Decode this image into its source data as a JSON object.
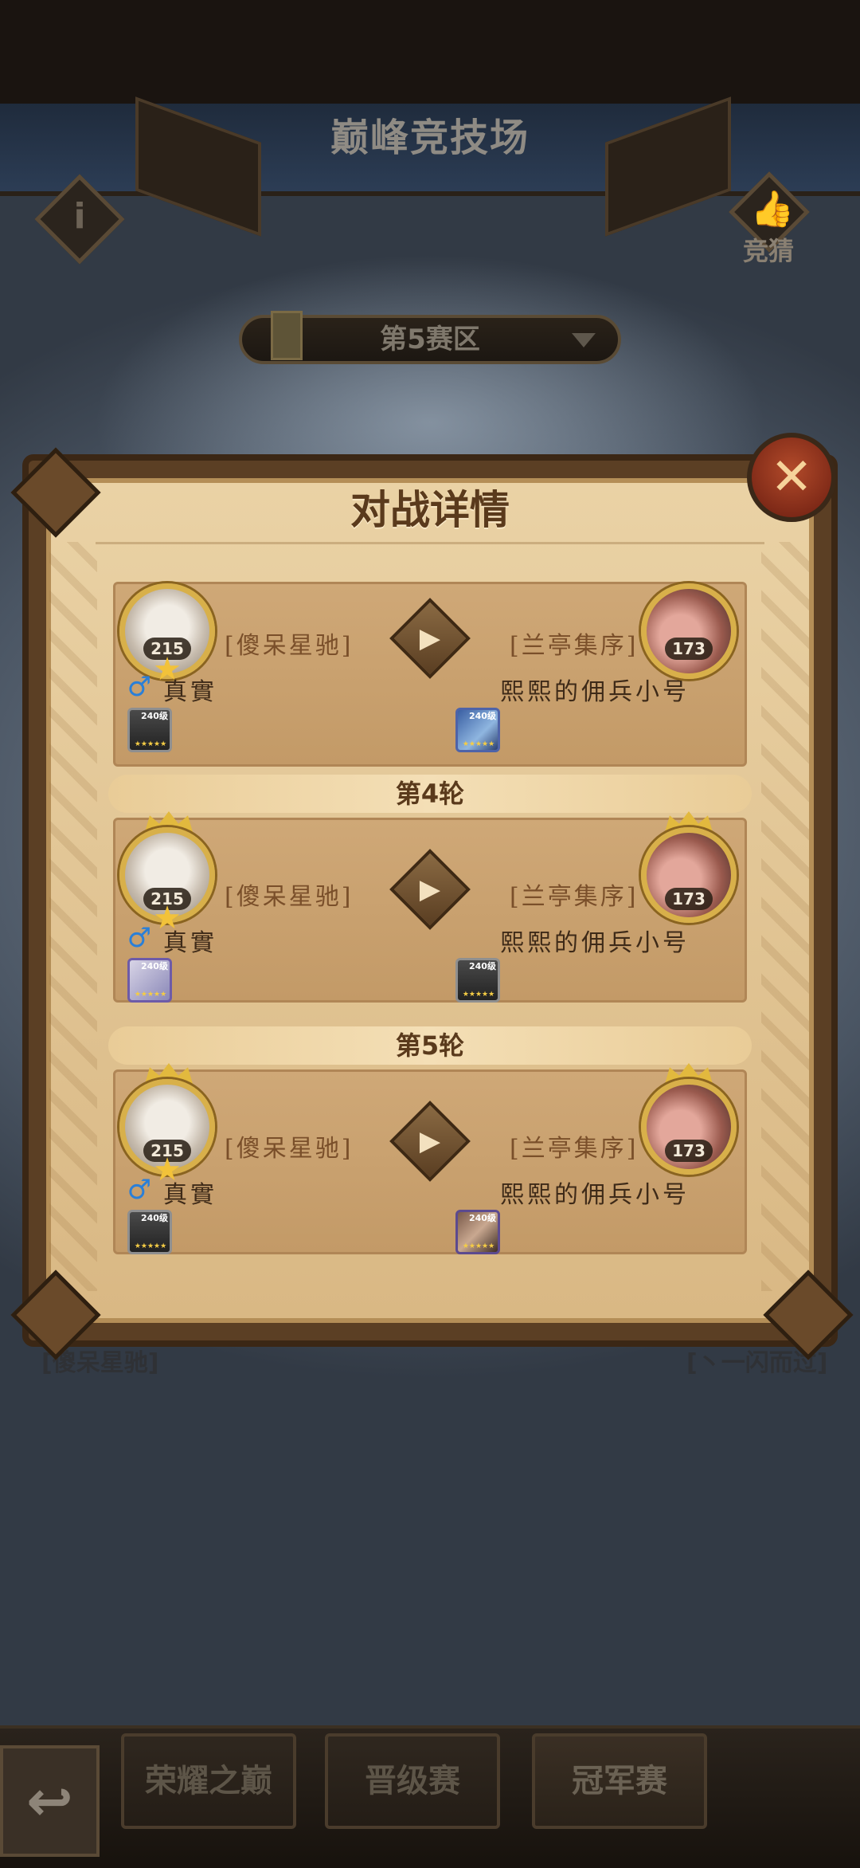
{
  "header": {
    "title": "巅峰竞技场",
    "guess_label": "竞猜"
  },
  "zone_select": {
    "value": "第5赛区"
  },
  "background_players": {
    "left": "[傻呆星驰]",
    "right": "[丶一闪而过]"
  },
  "dialog": {
    "title": "对战详情",
    "matches": [
      {
        "left": {
          "guild": "[傻呆星驰]",
          "name": "真實",
          "level": "215"
        },
        "right": {
          "guild": "[兰亭集序]",
          "name": "熙熙的佣兵小号",
          "level": "173"
        },
        "left_hero_level": "240级",
        "right_hero_level": "240级"
      },
      {
        "round_label": "第4轮",
        "left": {
          "guild": "[傻呆星驰]",
          "name": "真實",
          "level": "215"
        },
        "right": {
          "guild": "[兰亭集序]",
          "name": "熙熙的佣兵小号",
          "level": "173"
        },
        "left_hero_level": "240级",
        "right_hero_level": "240级"
      },
      {
        "round_label": "第5轮",
        "left": {
          "guild": "[傻呆星驰]",
          "name": "真實",
          "level": "215"
        },
        "right": {
          "guild": "[兰亭集序]",
          "name": "熙熙的佣兵小号",
          "level": "173"
        },
        "left_hero_level": "240级",
        "right_hero_level": "240级"
      }
    ],
    "hero_stars": "★★★★★"
  },
  "bottom_nav": {
    "tab1": "荣耀之巅",
    "tab2": "晋级赛",
    "tab3": "冠军赛"
  },
  "colors": {
    "accent_gold": "#d8b04a",
    "paper": "#ead2a5",
    "text_brown": "#5a3a1c"
  }
}
